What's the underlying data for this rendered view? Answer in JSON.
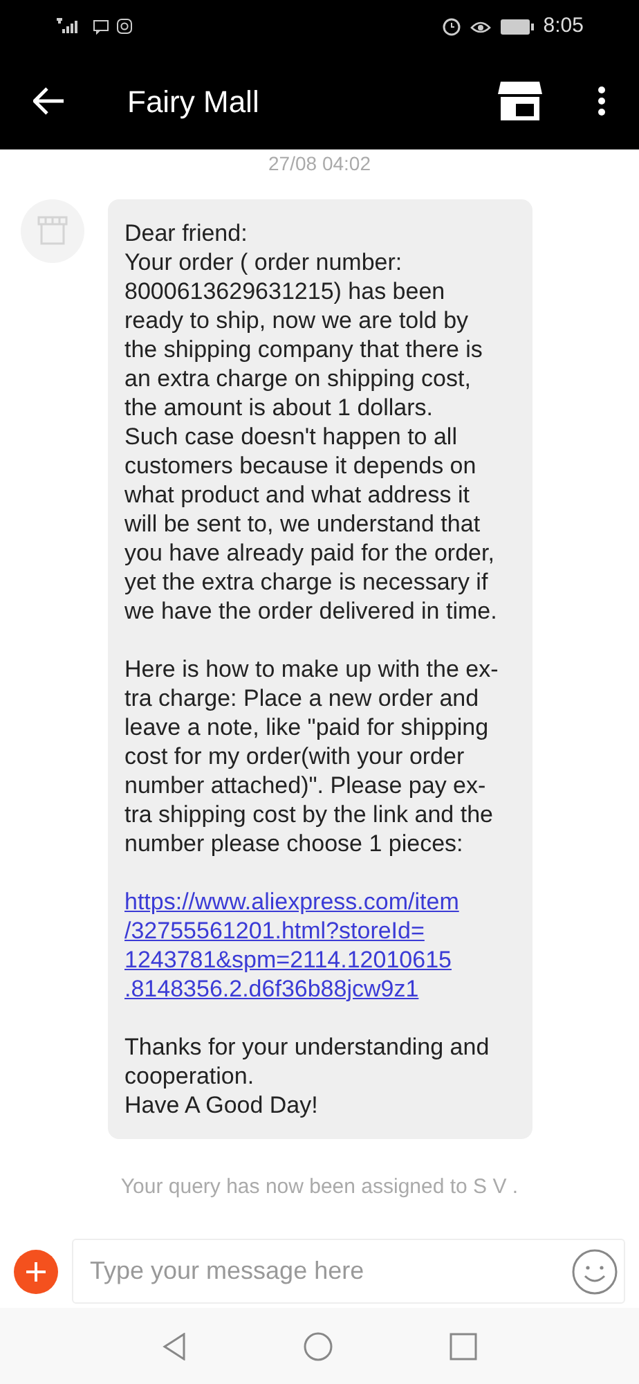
{
  "status_bar": {
    "time": "8:05"
  },
  "header": {
    "title": "Fairy Mall"
  },
  "timestamp": "27/08 04:02",
  "message": {
    "paragraphs": [
      {
        "kind": "text",
        "lines": [
          "Dear friend:",
          "Your order ( order number:",
          "8000613629631215) has been",
          "ready to ship, now we are told by",
          "the shipping company that there is",
          "an extra charge on shipping cost,",
          "the amount is about 1 dollars.",
          "Such case doesn't happen to all",
          "customers because it depends on",
          "what product and what address it",
          "will be sent to, we understand that",
          "you have already paid for the order,",
          "yet the extra charge is necessary if",
          "we have the order delivered in time."
        ]
      },
      {
        "kind": "text",
        "lines": [
          "Here is how to make up with the ex-",
          "tra charge: Place a new order and",
          "leave a note, like \"paid for shipping",
          "cost for my order(with your order",
          "number attached)\". Please pay ex-",
          "tra shipping cost by the link and the",
          "number please choose 1 pieces:"
        ]
      },
      {
        "kind": "link",
        "lines": [
          "https://www.aliexpress.com/item",
          "/32755561201.html?storeId=",
          "1243781&spm=2114.12010615",
          ".8148356.2.d6f36b88jcw9z1"
        ]
      },
      {
        "kind": "text",
        "lines": [
          "Thanks for your understanding and",
          "cooperation.",
          "Have A Good Day!"
        ]
      }
    ]
  },
  "system_note": "Your query has now been assigned to S V .",
  "composer": {
    "placeholder": "Type your message here"
  }
}
